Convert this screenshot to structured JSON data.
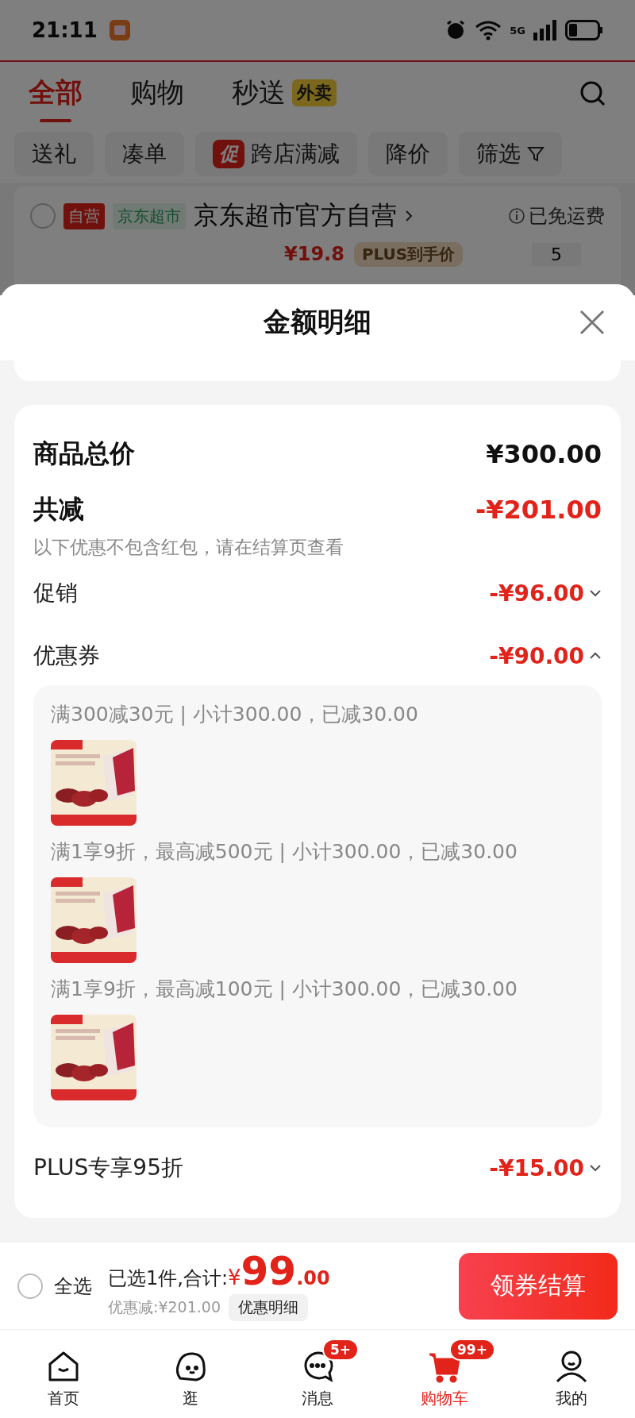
{
  "status_bar": {
    "time": "21:11",
    "network": "5G"
  },
  "top_tabs": [
    {
      "label": "全部",
      "selected": true
    },
    {
      "label": "购物",
      "selected": false
    },
    {
      "label": "秒送",
      "badge": "外卖",
      "selected": false
    }
  ],
  "filter_chips": [
    {
      "label": "送礼"
    },
    {
      "label": "凑单"
    },
    {
      "label": "跨店满减",
      "tag": "促"
    },
    {
      "label": "降价"
    },
    {
      "label": "筛选",
      "kind": "filter"
    }
  ],
  "store": {
    "checked": false,
    "tags": [
      {
        "label": "自营",
        "kind": "solid"
      },
      {
        "label": "京东超市",
        "kind": "soft"
      }
    ],
    "name": "京东超市官方自营",
    "shipping": "已免运费"
  },
  "item_partial": {
    "price": "¥19.8",
    "price_tag": "PLUS到手价",
    "quantity": "5"
  },
  "sheet": {
    "title": "金额明细",
    "total": {
      "label": "商品总价",
      "value": "¥300.00"
    },
    "reduction": {
      "label": "共减",
      "value": "-¥201.00",
      "note": "以下优惠不包含红包，请在结算页查看"
    },
    "discounts": [
      {
        "label": "促销",
        "value": "-¥96.00",
        "expanded": false
      },
      {
        "label": "优惠券",
        "value": "-¥90.00",
        "expanded": true,
        "coupons": [
          {
            "text": "满300减30元 | 小计300.00，已减30.00"
          },
          {
            "text": "满1享9折，最高减500元 | 小计300.00，已减30.00"
          },
          {
            "text": "满1享9折，最高减100元 | 小计300.00，已减30.00"
          }
        ]
      },
      {
        "label": "PLUS专享95折",
        "value": "-¥15.00",
        "expanded": false
      }
    ]
  },
  "checkout": {
    "select_all": {
      "label": "全选",
      "checked": false
    },
    "summary": "已选1件,合计:",
    "currency": "¥",
    "amount_int": "99",
    "amount_dec": ".00",
    "saved": "优惠减:¥201.00",
    "detail_button": "优惠明细",
    "button": "领券结算"
  },
  "nav": [
    {
      "label": "首页",
      "kind": "home",
      "selected": false
    },
    {
      "label": "逛",
      "kind": "face",
      "selected": false
    },
    {
      "label": "消息",
      "kind": "chat",
      "badge": "5+",
      "selected": false
    },
    {
      "label": "购物车",
      "kind": "cart",
      "badge": "99+",
      "selected": true
    },
    {
      "label": "我的",
      "kind": "person",
      "selected": false
    }
  ]
}
